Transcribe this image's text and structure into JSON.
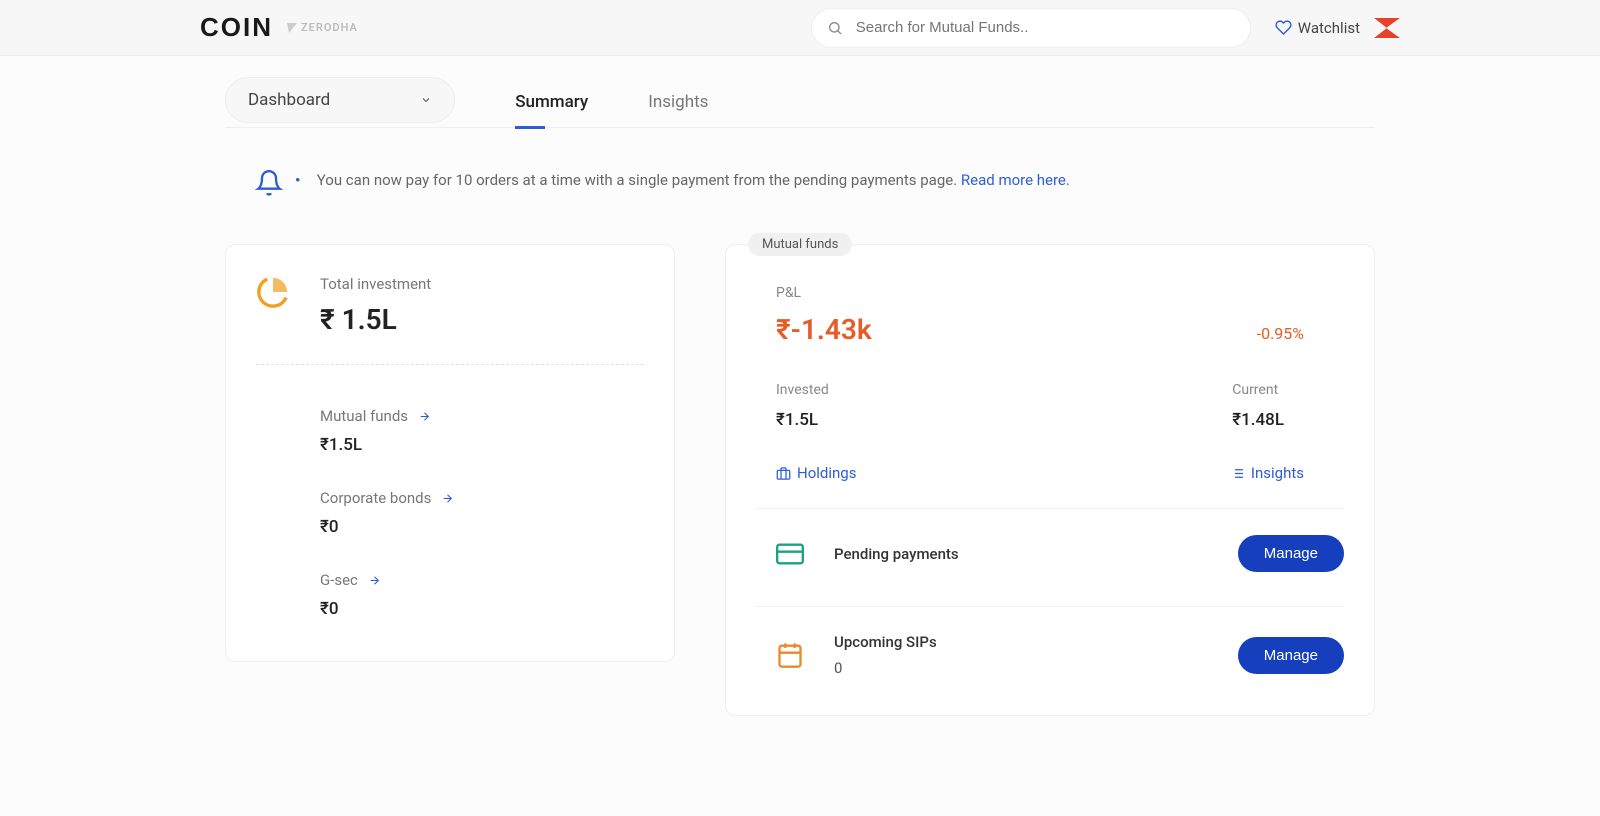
{
  "header": {
    "logo": "COIN",
    "sublogo": "ZERODHA",
    "searchPlaceholder": "Search for Mutual Funds..",
    "watchlist": "Watchlist"
  },
  "nav": {
    "dropdown": "Dashboard",
    "tabs": [
      "Summary",
      "Insights"
    ],
    "activeTab": 0
  },
  "notice": {
    "text": "You can now pay for 10 orders at a time with a single payment from the pending payments page. ",
    "link": "Read more here."
  },
  "portfolio": {
    "totalLabel": "Total investment",
    "totalValue": "₹ 1.5L",
    "categories": [
      {
        "label": "Mutual funds",
        "value": "₹1.5L"
      },
      {
        "label": "Corporate bonds",
        "value": "₹0"
      },
      {
        "label": "G-sec",
        "value": "₹0"
      }
    ]
  },
  "mutualFunds": {
    "badge": "Mutual funds",
    "pnlLabel": "P&L",
    "pnlValue": "₹-1.43k",
    "pnlPct": "-0.95%",
    "investedLabel": "Invested",
    "investedValue": "₹1.5L",
    "currentLabel": "Current",
    "currentValue": "₹1.48L",
    "holdingsLink": "Holdings",
    "insightsLink": "Insights",
    "pendingPayments": {
      "label": "Pending payments",
      "button": "Manage"
    },
    "upcomingSips": {
      "label": "Upcoming SIPs",
      "count": "0",
      "button": "Manage"
    }
  }
}
